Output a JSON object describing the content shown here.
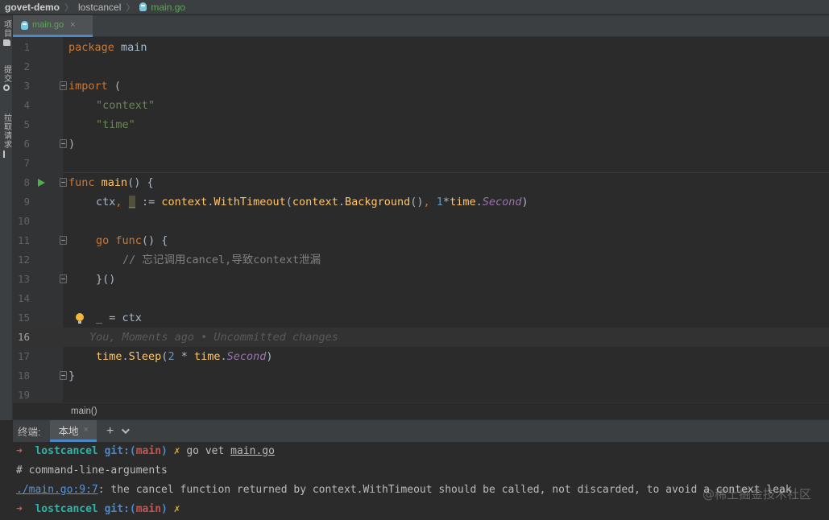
{
  "nav": {
    "project": "govet-demo",
    "folder": "lostcancel",
    "file": "main.go"
  },
  "left_strip": {
    "items": [
      {
        "label": "项目",
        "icon": "folder-icon"
      },
      {
        "label": "提交",
        "icon": "commit-icon"
      },
      {
        "label": "拉取请求",
        "icon": "pull-request-icon"
      }
    ]
  },
  "editor": {
    "tab": {
      "label": "main.go",
      "close": "×"
    },
    "lines": [
      {
        "n": "1"
      },
      {
        "n": "2"
      },
      {
        "n": "3"
      },
      {
        "n": "4"
      },
      {
        "n": "5"
      },
      {
        "n": "6"
      },
      {
        "n": "7"
      },
      {
        "n": "8"
      },
      {
        "n": "9"
      },
      {
        "n": "10"
      },
      {
        "n": "11"
      },
      {
        "n": "12"
      },
      {
        "n": "13"
      },
      {
        "n": "14"
      },
      {
        "n": "15"
      },
      {
        "n": "16"
      },
      {
        "n": "17"
      },
      {
        "n": "18"
      },
      {
        "n": "19"
      }
    ],
    "tokens": {
      "l1_kw": "package",
      "l1_rest": " main",
      "l3_kw": "import",
      "l3_rest": " (",
      "l4": "\"context\"",
      "l5": "\"time\"",
      "l6": ")",
      "l8_kw": "func",
      "l8_fn": " main",
      "l8_rest": "() {",
      "l9_a": "ctx",
      "l9_comma": ",",
      "l9_us": "_",
      "l9_b": " := ",
      "l9_pkg": "context",
      "l9_dot": ".",
      "l9_fn": "WithTimeout",
      "l9_c": "(",
      "l9_pkg2": "context",
      "l9_dot2": ".",
      "l9_fn2": "Background",
      "l9_d": "()",
      "l9_comma2": ",",
      "l9_num": " 1",
      "l9_star": "*",
      "l9_pkg3": "time",
      "l9_dot3": ".",
      "l9_sp": "Second",
      "l9_e": ")",
      "l11_kw": "go",
      "l11_kw2": " func",
      "l11_rest": "() {",
      "l12_cmt": "// 忘记调用cancel,导致context泄漏",
      "l13": "}()",
      "l15": "_ = ctx",
      "l16_blame": "You, Moments ago • Uncommitted changes",
      "l17_pkg": "time",
      "l17_dot": ".",
      "l17_fn": "Sleep",
      "l17_a": "(",
      "l17_num": "2",
      "l17_b": " * ",
      "l17_pkg2": "time",
      "l17_dot2": ".",
      "l17_sp": "Second",
      "l17_c": ")",
      "l18": "}"
    },
    "breadcrumb": "main()"
  },
  "terminal": {
    "title": "终端:",
    "tab_label": "本地",
    "tab_close": "×",
    "add_label": "+",
    "lines": {
      "p1_arrow": "➜",
      "p1_dir": "lostcancel",
      "p1_git": "git:(",
      "p1_branch": "main",
      "p1_git_end": ")",
      "p1_x": "✗",
      "p1_cmd_a": "go vet ",
      "p1_cmd_b": "main.go",
      "out1": "# command-line-arguments",
      "out2_link": "./main.go:9:7",
      "out2_rest": ": the cancel function returned by context.WithTimeout should be called, not discarded, to avoid a context leak",
      "p2_arrow": "➜",
      "p2_dir": "lostcancel",
      "p2_git": "git:(",
      "p2_branch": "main",
      "p2_git_end": ")",
      "p2_x": "✗"
    }
  },
  "watermark": "@稀土掘金技术社区"
}
